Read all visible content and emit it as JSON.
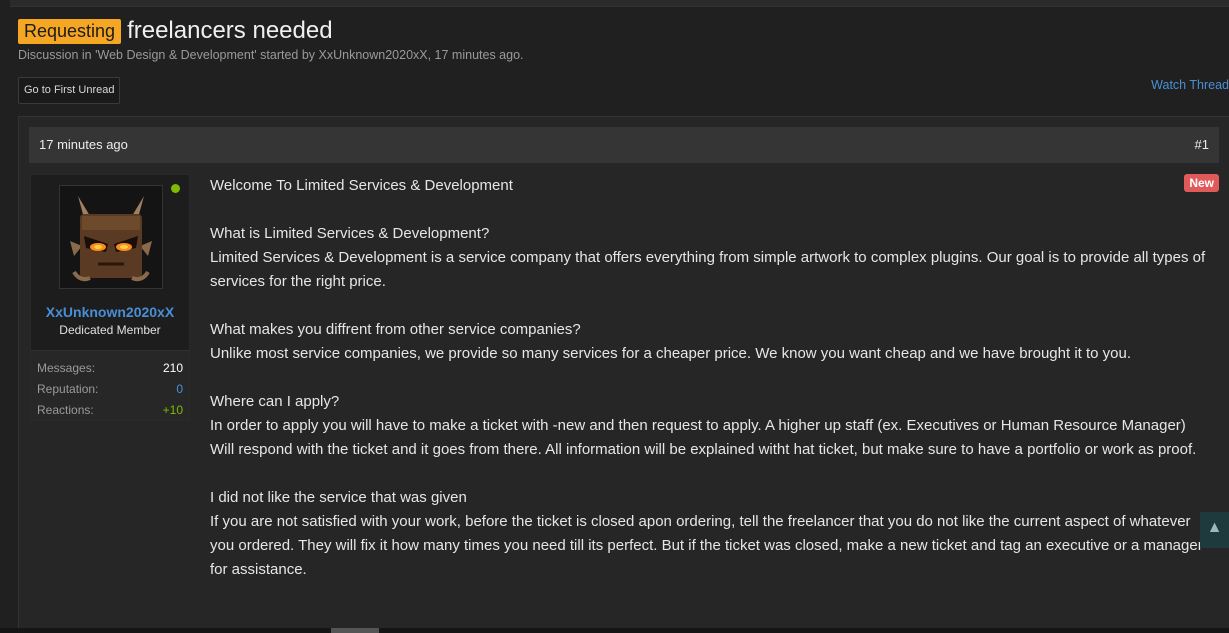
{
  "thread": {
    "prefix": "Requesting",
    "title": "freelancers needed",
    "meta": "Discussion in 'Web Design & Development' started by XxUnknown2020xX, 17 minutes ago.",
    "first_unread_label": "Go to First Unread",
    "watch_label": "Watch Thread"
  },
  "post": {
    "time": "17 minutes ago",
    "number": "#1",
    "new_badge": "New",
    "user": {
      "name": "XxUnknown2020xX",
      "title": "Dedicated Member",
      "online": true,
      "avatar_icon": "character-avatar",
      "stats": [
        {
          "label": "Messages:",
          "value": "210",
          "color": "#ffffff"
        },
        {
          "label": "Reputation:",
          "value": "0",
          "color": "#4a8fd6"
        },
        {
          "label": "Reactions:",
          "value": "+10",
          "color": "#7fba00"
        }
      ]
    },
    "paragraphs": [
      [
        "Welcome To Limited Services & Development"
      ],
      [
        "What is Limited Services & Development?",
        "Limited Services & Development is a service company that offers everything from simple artwork to complex plugins. Our goal is to provide all types of services for the right price."
      ],
      [
        "What makes you diffrent from other service companies?",
        "Unlike most service companies, we provide so many services for a cheaper price. We know you want cheap and we have brought it to you."
      ],
      [
        "Where can I apply?",
        "In order to apply you will have to make a ticket with -new and then request to apply. A higher up staff (ex. Executives or Human Resource Manager) Will respond with the ticket and it goes from there. All information will be explained witht hat ticket, but make sure to have a portfolio or work as proof."
      ],
      [
        "I did not like the service that was given",
        "If you are not satisfied with your work, before the ticket is closed apon ordering, tell the freelancer that you do not like the current aspect of whatever you ordered. They will fix it how many times you need till its perfect. But if the ticket was closed, make a new ticket and tag an executive or a manager for assistance."
      ]
    ]
  },
  "icons": {
    "scroll_top": "chevron-up-icon",
    "online": "online-status-dot"
  },
  "colors": {
    "prefix": "#f5a623",
    "link": "#4a8fd6",
    "new_badge": "#e05a5a",
    "online": "#7fba00"
  }
}
